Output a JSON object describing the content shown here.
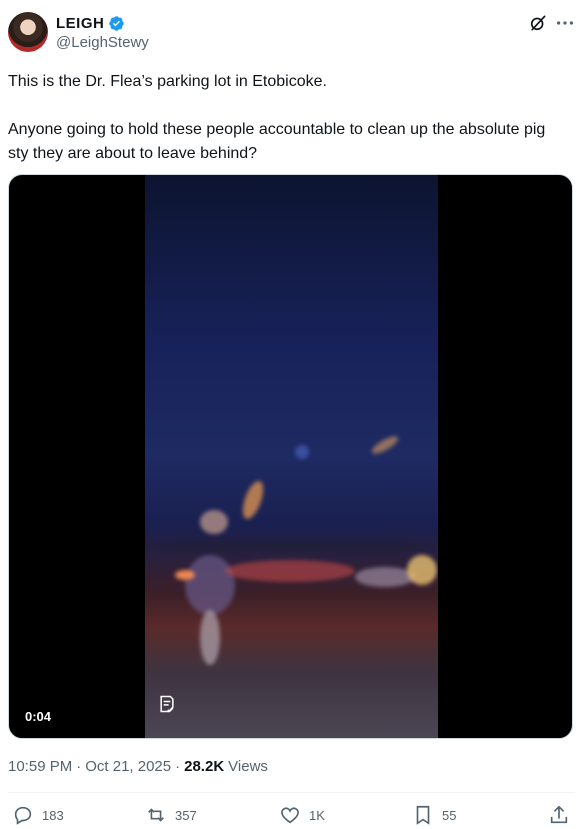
{
  "author": {
    "display_name": "LEIGH",
    "handle": "@LeighStewy",
    "verified_color": "#1d9bf0"
  },
  "tweet": {
    "text": "This is the Dr. Flea’s parking lot in Etobicoke.\n\nAnyone going to hold these people accountable to clean up the absolute pig sty they are about to leave behind?"
  },
  "media": {
    "type": "video",
    "duration": "0:04"
  },
  "meta": {
    "time": "10:59 PM",
    "date": "Oct 21, 2025",
    "separator": "·",
    "views_count": "28.2K",
    "views_label": "Views"
  },
  "actions": {
    "replies": "183",
    "reposts": "357",
    "likes": "1K",
    "bookmarks": "55"
  },
  "icons": [
    "verified-icon",
    "grok-icon",
    "more-icon",
    "caption-icon",
    "reply-icon",
    "repost-icon",
    "like-icon",
    "bookmark-icon",
    "share-icon"
  ]
}
